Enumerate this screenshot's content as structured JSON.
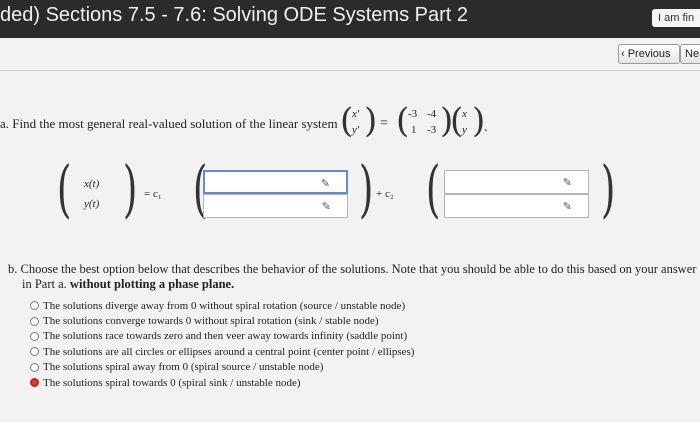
{
  "header": {
    "title": "ded) Sections 7.5 - 7.6: Solving ODE Systems Part 2",
    "user_label": "I am fin"
  },
  "nav": {
    "previous_label": "‹ Previous",
    "next_label": "Ne"
  },
  "part_a": {
    "prefix": "a. Find the most general real-valued solution of the linear system",
    "lhs_top": "x′",
    "lhs_bottom": "y′",
    "equals": "=",
    "matrix": {
      "a11": "-3",
      "a12": "-4",
      "a21": "1",
      "a22": "-3"
    },
    "rhs_top": "x",
    "rhs_bottom": "y",
    "period": "."
  },
  "solution": {
    "x_label": "x(t)",
    "y_label": "y(t)",
    "eq_c1": "= c₁",
    "plus_c2": "+ c₂",
    "fields": [
      {
        "value": "",
        "active": true
      },
      {
        "value": "",
        "active": false
      },
      {
        "value": "",
        "active": false
      },
      {
        "value": "",
        "active": false
      }
    ]
  },
  "part_b": {
    "prompt_line1": "b. Choose the best option below that describes the behavior of the solutions. Note that you should be able to do this based on your answer",
    "prompt_line2_pre": "in Part a. ",
    "prompt_line2_bold": "without plotting a phase plane.",
    "options": [
      {
        "label": "The solutions diverge away from 0 without spiral rotation (source / unstable node)",
        "selected": false
      },
      {
        "label": "The solutions converge towards 0 without spiral rotation (sink / stable node)",
        "selected": false
      },
      {
        "label": "The solutions race towards zero and then veer away towards infinity (saddle point)",
        "selected": false
      },
      {
        "label": "The solutions are all circles or ellipses around a central point (center point / ellipses)",
        "selected": false
      },
      {
        "label": "The solutions spiral away from 0 (spiral source / unstable node)",
        "selected": false
      },
      {
        "label": "The solutions spiral towards 0 (spiral sink / unstable node)",
        "selected": true
      }
    ]
  },
  "colors": {
    "header_bg": "#2b2b2b",
    "selected_radio": "#e53a2a",
    "active_field_border": "#5b8fd0"
  }
}
